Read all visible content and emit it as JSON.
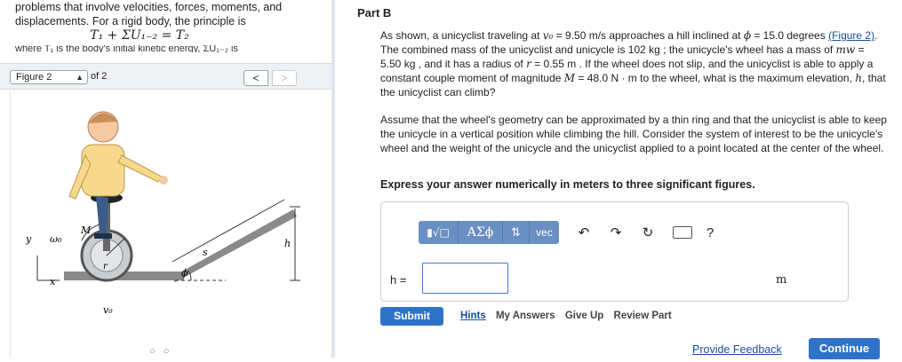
{
  "intro": {
    "line1": "problems that involve velocities, forces, moments, and",
    "line2": "displacements. For a rigid body, the principle is",
    "equation": "T₁ + ΣU₁₋₂ = T₂",
    "cut_line": "where T₁ is the body's initial kinetic energy, ΣU₁₋₂ is"
  },
  "figure_nav": {
    "selected": "Figure 2",
    "of_label": "of 2",
    "prev_glyph": "<",
    "next_glyph": ">",
    "labels": {
      "y": "y",
      "x": "x",
      "omega0": "ω₀",
      "M": "M",
      "r": "r",
      "s": "s",
      "h": "h",
      "phi": "ϕ",
      "v0": "v₀"
    },
    "page_dots": "○ ○"
  },
  "part": {
    "title": "Part B",
    "p1": {
      "t1": "As shown, a unicyclist traveling at ",
      "v0": "v₀",
      "t2": " = 9.50 m/s approaches a hill inclined at ",
      "phi": "ϕ",
      "t3": " = 15.0 degrees ",
      "fig_link": "(Figure 2)",
      "t4": ". The combined mass of the unicyclist and unicycle is 102 kg ; the unicycle's wheel has a mass of ",
      "mw": "mw",
      "t5": " = 5.50 kg , and it has a radius of ",
      "r": "r",
      "t6": " = 0.55 m . If the wheel does not slip, and the unicyclist is able to apply a constant couple moment of magnitude ",
      "M": "M",
      "t7": " = 48.0 N · m to the wheel, what is the maximum elevation, ",
      "h": "h",
      "t8": ", that the unicyclist can climb?"
    },
    "p2": "Assume that the wheel's geometry can be approximated by a thin ring and that the unicyclist is able to keep the unicycle in a vertical position while climbing the hill. Consider the system of interest to be the unicycle's wheel and the weight of the unicycle and the unicyclist applied to a point located at the center of the wheel.",
    "p3": "Express your answer numerically in meters to three significant figures."
  },
  "toolbar": {
    "frac_label": "▮√□",
    "greek_label": "ΑΣϕ",
    "updown_label": "⇅",
    "vec_label": "vec",
    "help_label": "?"
  },
  "answer": {
    "label": "h =",
    "value": "",
    "unit": "m"
  },
  "actions": {
    "submit": "Submit",
    "hints": "Hints",
    "my_answers": "My Answers",
    "give_up": "Give Up",
    "review_part": "Review Part",
    "feedback": "Provide Feedback",
    "continue": "Continue"
  },
  "colors": {
    "accent": "#2f73c8",
    "toolbar": "#6a8fc2",
    "link": "#1a4d99"
  }
}
